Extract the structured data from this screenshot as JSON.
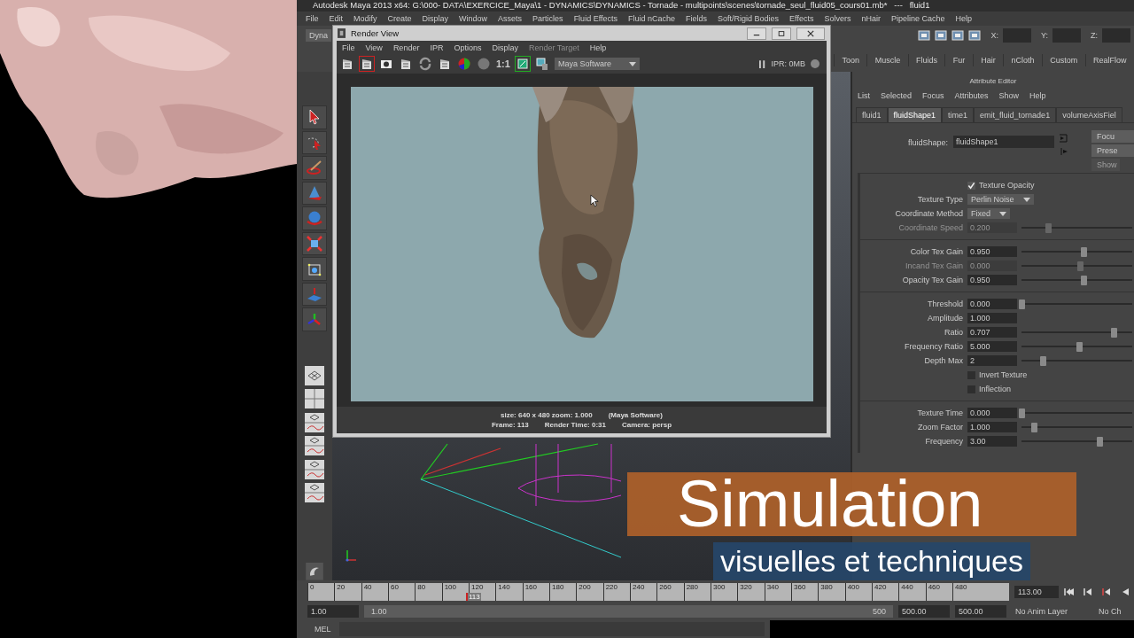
{
  "window": {
    "title": "Autodesk Maya 2013 x64: G:\\000- DATA\\EXERCICE_Maya\\1 - DYNAMICS\\DYNAMICS - Tornade - multipoints\\scenes\\tornade_seul_fluid05_cours01.mb*   ---   fluid1"
  },
  "menu": [
    "File",
    "Edit",
    "Modify",
    "Create",
    "Display",
    "Window",
    "Assets",
    "Particles",
    "Fluid Effects",
    "Fluid nCache",
    "Fields",
    "Soft/Rigid Bodies",
    "Effects",
    "Solvers",
    "nHair",
    "Pipeline Cache",
    "Help"
  ],
  "status_line": {
    "mode": "Dyna",
    "coords": [
      "X:",
      "Y:",
      "Z:"
    ]
  },
  "shelf_tabs": [
    {
      "label": "Toon",
      "selected": false
    },
    {
      "label": "Muscle",
      "selected": false
    },
    {
      "label": "Fluids",
      "selected": false
    },
    {
      "label": "Fur",
      "selected": false
    },
    {
      "label": "Hair",
      "selected": false
    },
    {
      "label": "nCloth",
      "selected": false
    },
    {
      "label": "Custom",
      "selected": false
    },
    {
      "label": "RealFlow",
      "selected": false
    }
  ],
  "render_view": {
    "title": "Render View",
    "menu": [
      {
        "label": "File",
        "disabled": false
      },
      {
        "label": "View",
        "disabled": false
      },
      {
        "label": "Render",
        "disabled": false
      },
      {
        "label": "IPR",
        "disabled": false
      },
      {
        "label": "Options",
        "disabled": false
      },
      {
        "label": "Display",
        "disabled": false
      },
      {
        "label": "Render Target",
        "disabled": true
      },
      {
        "label": "Help",
        "disabled": false
      }
    ],
    "ratio": "1:1",
    "renderer": "Maya Software",
    "ipr": "IPR: 0MB",
    "info": [
      [
        "size: 640 x 480 zoom: 1.000",
        "(Maya Software)"
      ],
      [
        "Frame: 113",
        "Render Time: 0:31",
        "Camera: persp"
      ]
    ]
  },
  "attribute_editor": {
    "title": "Attribute Editor",
    "menu": [
      "List",
      "Selected",
      "Focus",
      "Attributes",
      "Show",
      "Help"
    ],
    "tabs": [
      {
        "label": "fluid1",
        "selected": false
      },
      {
        "label": "fluidShape1",
        "selected": true
      },
      {
        "label": "time1",
        "selected": false
      },
      {
        "label": "emit_fluid_tornade1",
        "selected": false
      },
      {
        "label": "volumeAxisFiel",
        "selected": false
      }
    ],
    "node": {
      "label": "fluidShape:",
      "value": "fluidShape1"
    },
    "buttons": [
      "Focu",
      "Prese",
      "Show"
    ],
    "sections": [
      {
        "rows": [
          {
            "kind": "checkbox",
            "label": "Texture Opacity",
            "checked": true
          },
          {
            "kind": "dropdown",
            "label": "Texture Type",
            "value": "Perlin Noise"
          },
          {
            "kind": "dropdown",
            "label": "Coordinate Method",
            "value": "Fixed"
          },
          {
            "kind": "slider",
            "label": "Coordinate Speed",
            "value": "0.200",
            "level": 0.24,
            "disabled": true
          }
        ]
      },
      {
        "rows": [
          {
            "kind": "slider",
            "label": "Color Tex Gain",
            "value": "0.950",
            "level": 0.56,
            "disabled": false
          },
          {
            "kind": "slider",
            "label": "Incand Tex Gain",
            "value": "0.000",
            "level": 0.53,
            "disabled": true
          },
          {
            "kind": "slider",
            "label": "Opacity Tex Gain",
            "value": "0.950",
            "level": 0.56,
            "disabled": false
          }
        ]
      },
      {
        "rows": [
          {
            "kind": "slider",
            "label": "Threshold",
            "value": "0.000",
            "level": 0.0,
            "disabled": false
          },
          {
            "kind": "field",
            "label": "Amplitude",
            "value": "1.000"
          },
          {
            "kind": "slider",
            "label": "Ratio",
            "value": "0.707",
            "level": 0.83,
            "disabled": false
          },
          {
            "kind": "slider",
            "label": "Frequency Ratio",
            "value": "5.000",
            "level": 0.52,
            "disabled": false
          },
          {
            "kind": "slider",
            "label": "Depth Max",
            "value": "2",
            "level": 0.19,
            "disabled": false
          },
          {
            "kind": "checkbox",
            "label": "Invert Texture",
            "checked": false
          },
          {
            "kind": "checkbox",
            "label": "Inflection",
            "checked": false
          }
        ]
      },
      {
        "rows": [
          {
            "kind": "slider",
            "label": "Texture Time",
            "value": "0.000",
            "level": 0.0,
            "disabled": false
          },
          {
            "kind": "slider",
            "label": "Zoom Factor",
            "value": "1.000",
            "level": 0.11,
            "disabled": false
          },
          {
            "kind": "slider",
            "label": "Frequency",
            "value": "3.00",
            "level": 0.7,
            "disabled": false
          }
        ]
      }
    ]
  },
  "time_slider": {
    "ticks": [
      "0",
      "20",
      "40",
      "60",
      "80",
      "100",
      "120",
      "140",
      "160",
      "180",
      "200",
      "220",
      "240",
      "260",
      "280",
      "300",
      "320",
      "340",
      "360",
      "380",
      "400",
      "420",
      "440",
      "460",
      "480"
    ],
    "current": "113",
    "level": 0.226,
    "current_field": "113.00"
  },
  "range_slider": {
    "level": 1,
    "start": "1.00",
    "range_start": "1.00",
    "range_end": "500",
    "end": "500.00",
    "max": "500.00",
    "anim_layer": "No Anim Layer",
    "character": "No Ch"
  },
  "command_line": {
    "label": "MEL"
  },
  "video_title": {
    "title": "Simulation",
    "subtitle": "visuelles et techniques"
  }
}
